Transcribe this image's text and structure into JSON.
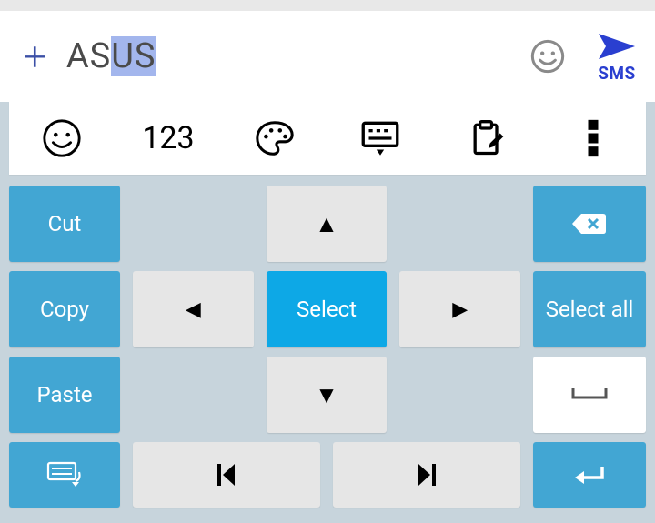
{
  "compose": {
    "plain": "AS",
    "highlighted": "US",
    "send_label": "SMS"
  },
  "toolbar": {
    "numbers_label": "123"
  },
  "keys": {
    "cut": "Cut",
    "copy": "Copy",
    "paste": "Paste",
    "select": "Select",
    "select_all": "Select all"
  }
}
